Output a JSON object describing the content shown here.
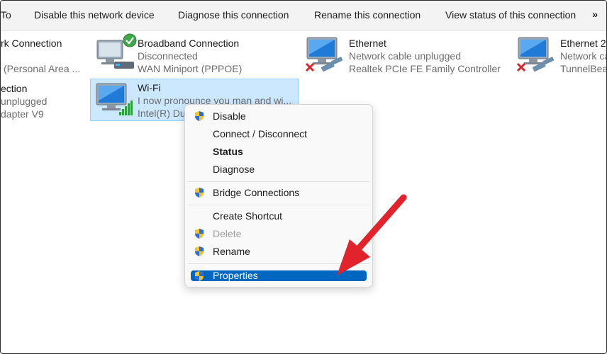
{
  "toolbar": {
    "organize_fragment": "To",
    "disable_device": "Disable this network device",
    "diagnose": "Diagnose this connection",
    "rename": "Rename this connection",
    "view_status": "View status of this connection",
    "more": "»"
  },
  "connections": [
    {
      "name": "rk Connection",
      "status": "",
      "device": "(Personal Area ..."
    },
    {
      "name": "Broadband Connection",
      "status": "Disconnected",
      "device": "WAN Miniport (PPPOE)"
    },
    {
      "name": "Ethernet",
      "status": "Network cable unplugged",
      "device": "Realtek PCIe FE Family Controller"
    },
    {
      "name": "Ethernet 2",
      "status": "Network ca",
      "device": "TunnelBea"
    },
    {
      "name": "ection",
      "status": "unplugged",
      "device": "dapter V9"
    },
    {
      "name": "Wi-Fi",
      "status": "I now pronounce you man and wi...",
      "device": "Intel(R) Du"
    }
  ],
  "context_menu": {
    "items": [
      {
        "label": "Disable",
        "shield": true
      },
      {
        "label": "Connect / Disconnect",
        "shield": false
      },
      {
        "label": "Status",
        "shield": false,
        "bold": true
      },
      {
        "label": "Diagnose",
        "shield": false
      },
      {
        "label": "Bridge Connections",
        "shield": true
      },
      {
        "label": "Create Shortcut",
        "shield": false
      },
      {
        "label": "Delete",
        "shield": true,
        "disabled": true
      },
      {
        "label": "Rename",
        "shield": true
      },
      {
        "label": "Properties",
        "shield": true,
        "highlighted": true
      }
    ]
  },
  "colors": {
    "selection_bg": "#cce8ff",
    "menu_highlight": "#0067c0",
    "annotation_arrow": "#e3232b"
  }
}
